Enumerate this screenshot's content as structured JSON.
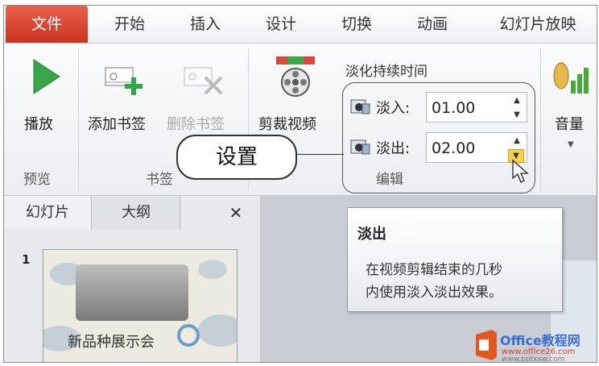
{
  "tabs": [
    "文件",
    "开始",
    "插入",
    "设计",
    "切换",
    "动画",
    "幻灯片放映"
  ],
  "groups": {
    "preview": {
      "label": "预览",
      "play_label": "播放"
    },
    "bookmarks": {
      "label": "书签",
      "add_label": "添加书签",
      "remove_label": "删除书签"
    },
    "editing": {
      "label": "编辑",
      "trim_label": "剪裁视频",
      "duration_title": "淡化持续时间",
      "fade_in_label": "淡入:",
      "fade_in_value": "01.00",
      "fade_out_label": "淡出:",
      "fade_out_value": "02.00"
    },
    "volume": {
      "label": "音量"
    }
  },
  "callout": "设置",
  "tooltip": {
    "title": "淡出",
    "line1": "在视频剪辑结束的几秒",
    "line2": "内使用淡入淡出效果。"
  },
  "panel": {
    "tab_slides": "幻灯片",
    "tab_outline": "大纲",
    "close": "✕",
    "slide_number": "1",
    "slide_title": "新品种展示会"
  },
  "watermark": {
    "brand": "Office教程网",
    "url": "www.office26.com",
    "url2": "www.pptxxw.com"
  },
  "colors": {
    "file_tab": "#d9412b",
    "play": "#3aa64a",
    "add": "#2fa84a",
    "volume": "#49a83a"
  }
}
